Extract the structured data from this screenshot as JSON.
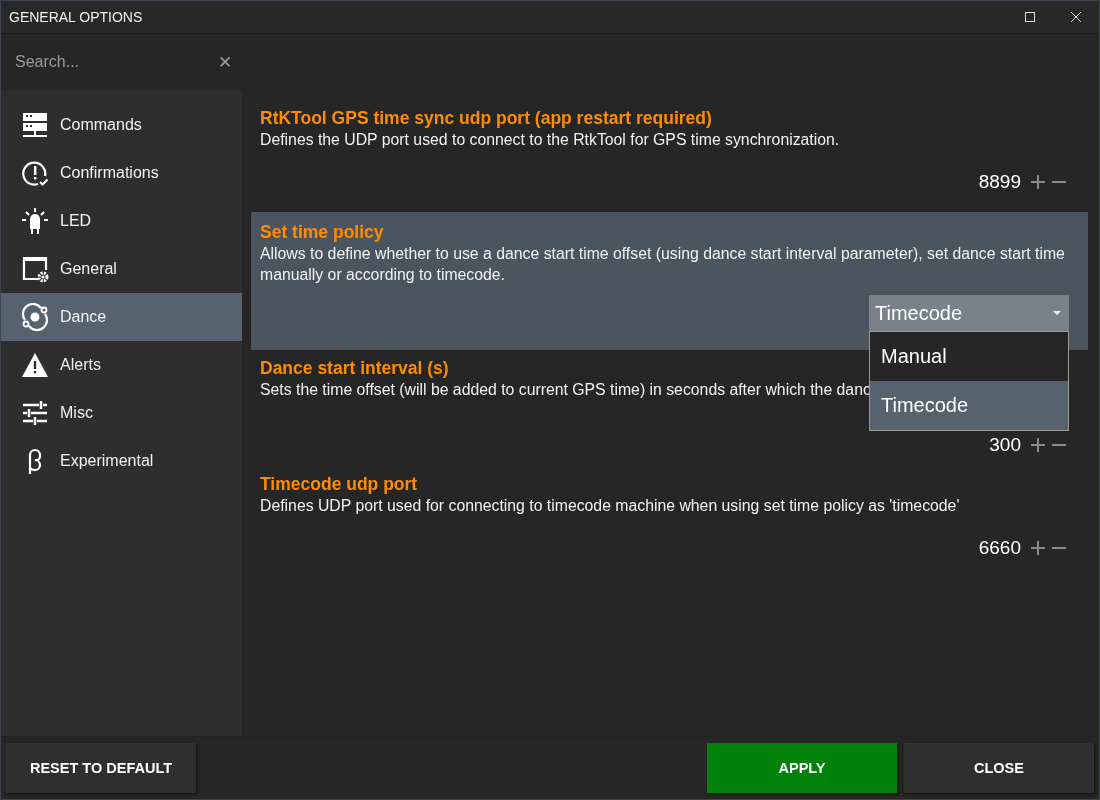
{
  "window": {
    "title": "GENERAL OPTIONS",
    "controls": [
      {
        "kind": "maximize"
      },
      {
        "kind": "close"
      }
    ]
  },
  "search": {
    "placeholder": "Search...",
    "clear": "✕"
  },
  "sidebar": {
    "items": [
      {
        "label": "Commands",
        "selected": false
      },
      {
        "label": "Confirmations",
        "selected": false
      },
      {
        "label": "LED",
        "selected": false
      },
      {
        "label": "General",
        "selected": false
      },
      {
        "label": "Dance",
        "selected": true
      },
      {
        "label": "Alerts",
        "selected": false
      },
      {
        "label": "Misc",
        "selected": false
      },
      {
        "label": "Experimental",
        "selected": false
      }
    ]
  },
  "settings": [
    {
      "kind": "number",
      "title": "RtKTool GPS time sync udp port (app restart required)",
      "description": "Defines the UDP port used to connect to the RtkTool for GPS time synchronization.",
      "value": "8899",
      "highlighted": false
    },
    {
      "kind": "dropdown",
      "title": "Set time policy",
      "description": "Allows to define whether to use a dance start time offset (using dance start interval parameter), set dance start time manually or according to timecode.",
      "value": "Timecode",
      "highlighted": true,
      "expanded": true,
      "options": [
        {
          "label": "Manual",
          "selected": false
        },
        {
          "label": "Timecode",
          "selected": true
        }
      ]
    },
    {
      "kind": "number",
      "title": "Dance start interval (s)",
      "description": "Sets the time offset (will be added to current GPS time) in seconds after which the danc",
      "value": "300",
      "highlighted": false
    },
    {
      "kind": "number",
      "title": "Timecode udp port",
      "description": "Defines UDP port used for connecting to timecode machine when using set time policy as 'timecode'",
      "value": "6660",
      "highlighted": false
    }
  ],
  "footer": {
    "buttons": [
      {
        "label": "RESET TO DEFAULT",
        "kind": "reset"
      },
      {
        "label": "APPLY",
        "kind": "primary"
      },
      {
        "label": "CLOSE",
        "kind": "plain"
      }
    ]
  }
}
